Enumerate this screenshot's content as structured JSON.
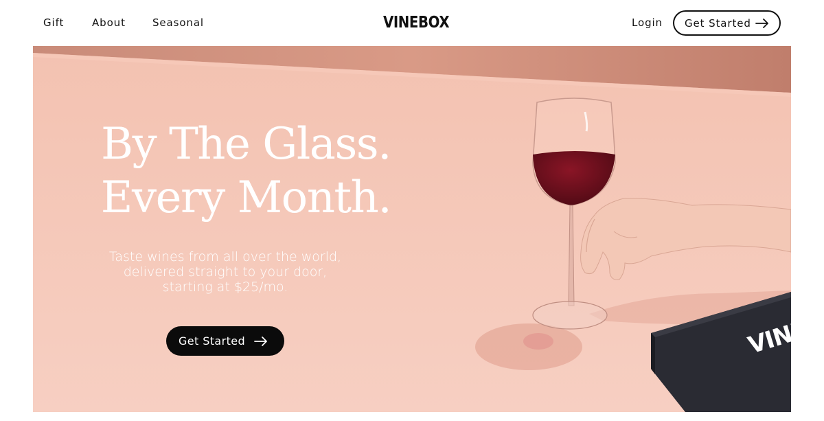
{
  "nav": {
    "links": [
      "Gift",
      "About",
      "Seasonal"
    ],
    "logo": "VINEBOX",
    "login": "Login",
    "cta": "Get Started"
  },
  "hero": {
    "title_lines": [
      "By The Glass.",
      "Every Month."
    ],
    "subtitle_lines": [
      "Taste wines from all over the world,",
      "delivered straight to your door,",
      "starting at $25/mo."
    ],
    "cta": "Get Started",
    "box_text": "VINE"
  },
  "colors": {
    "hero_background": "#f4c7b8",
    "wall": "#e0a18d",
    "wine": "#6b0f1a",
    "button_dark": "#0b0b0b",
    "box": "#2a2b33"
  },
  "icons": {
    "arrow": "arrow-right-icon"
  }
}
